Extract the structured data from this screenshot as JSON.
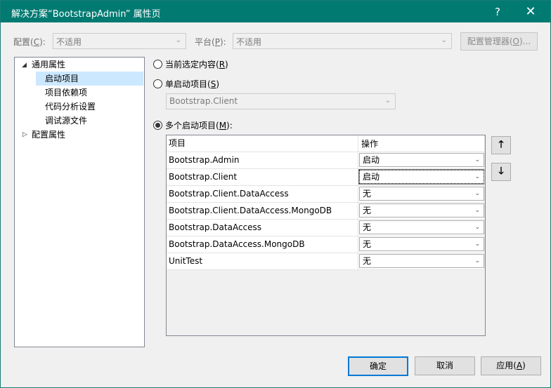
{
  "window": {
    "title": "解决方案“BootstrapAdmin” 属性页",
    "help_glyph": "?",
    "close_glyph": "✕"
  },
  "config_bar": {
    "config_label": "配置(",
    "config_key": "C",
    "config_label_end": "):",
    "config_value": "不适用",
    "platform_label": "平台(",
    "platform_key": "P",
    "platform_label_end": "):",
    "platform_value": "不适用",
    "manager_label": "配置管理器(",
    "manager_key": "O",
    "manager_label_end": ")..."
  },
  "tree": {
    "common": "通用属性",
    "startup": "启动项目",
    "deps": "项目依赖项",
    "analysis": "代码分析设置",
    "debug": "调试源文件",
    "config": "配置属性",
    "expanded_glyph": "◢",
    "collapsed_glyph": "▷"
  },
  "startup": {
    "current_label": "当前选定内容(",
    "current_key": "R",
    "current_end": ")",
    "single_label": "单启动项目(",
    "single_key": "S",
    "single_end": ")",
    "single_value": "Bootstrap.Client",
    "multiple_label": "多个启动项目(",
    "multiple_key": "M",
    "multiple_end": "):",
    "selected": "multiple"
  },
  "grid": {
    "col_project": "项目",
    "col_action": "操作",
    "rows": [
      {
        "project": "Bootstrap.Admin",
        "action": "启动"
      },
      {
        "project": "Bootstrap.Client",
        "action": "启动"
      },
      {
        "project": "Bootstrap.Client.DataAccess",
        "action": "无"
      },
      {
        "project": "Bootstrap.Client.DataAccess.MongoDB",
        "action": "无"
      },
      {
        "project": "Bootstrap.DataAccess",
        "action": "无"
      },
      {
        "project": "Bootstrap.DataAccess.MongoDB",
        "action": "无"
      },
      {
        "project": "UnitTest",
        "action": "无"
      }
    ]
  },
  "buttons": {
    "ok": "确定",
    "cancel": "取消",
    "apply_label": "应用(",
    "apply_key": "A",
    "apply_end": ")"
  },
  "glyphs": {
    "chevron": "⌄",
    "up": "🡑",
    "down": "🡓"
  }
}
